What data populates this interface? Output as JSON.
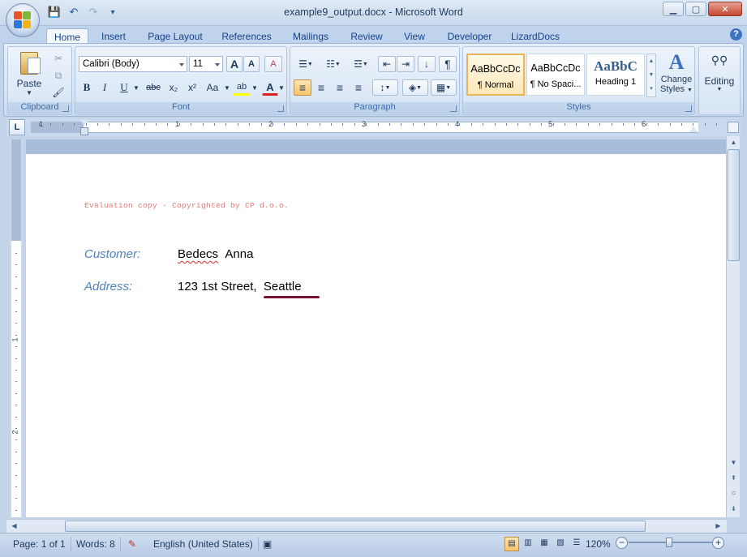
{
  "window": {
    "title": "example9_output.docx - Microsoft Word",
    "minimize": "▁",
    "maximize": "▢",
    "close": "✕"
  },
  "qat": {
    "save_icon": "💾",
    "undo_icon": "↶",
    "redo_icon": "↷",
    "customize_icon": "▾"
  },
  "tabs": [
    "Home",
    "Insert",
    "Page Layout",
    "References",
    "Mailings",
    "Review",
    "View",
    "Developer",
    "LizardDocs"
  ],
  "help": "?",
  "ribbon": {
    "clipboard": {
      "label": "Clipboard",
      "paste": "Paste",
      "cut_icon": "✂",
      "copy_icon": "⧉",
      "format_painter_icon": "🖌"
    },
    "font": {
      "label": "Font",
      "font_name": "Calibri (Body)",
      "font_size": "11",
      "grow": "A",
      "shrink": "A",
      "clear": "A",
      "bold": "B",
      "italic": "I",
      "underline": "U",
      "strike": "abc",
      "subscript": "x₂",
      "superscript": "x²",
      "change_case": "Aa",
      "highlight": "ab",
      "font_color": "A"
    },
    "paragraph": {
      "label": "Paragraph",
      "bullets_icon": "☰",
      "numbering_icon": "☷",
      "multilevel_icon": "☲",
      "decrease_indent_icon": "⇤",
      "increase_indent_icon": "⇥",
      "sort_icon": "↓",
      "pilcrow": "¶",
      "align_left_icon": "≡",
      "align_center_icon": "≡",
      "align_right_icon": "≡",
      "justify_icon": "≡",
      "line_spacing_icon": "↕",
      "shading_icon": "◈",
      "borders_icon": "▦"
    },
    "styles": {
      "label": "Styles",
      "tiles": [
        {
          "sample": "AaBbCcDc",
          "name": "¶ Normal"
        },
        {
          "sample": "AaBbCcDc",
          "name": "¶ No Spaci..."
        },
        {
          "sample": "AaBbC",
          "name": "Heading 1"
        }
      ],
      "change_styles_line1": "Change",
      "change_styles_line2": "Styles"
    },
    "editing": {
      "label": "Editing"
    }
  },
  "ruler": {
    "tab_selector": "L",
    "numbers": [
      "1",
      "1",
      "2",
      "3",
      "4",
      "5",
      "6"
    ]
  },
  "document": {
    "watermark": "Evaluation copy - Copyrighted by CP d.o.o.",
    "customer_label": "Customer:",
    "customer_first": "Bedecs",
    "customer_last": "Anna",
    "address_label": "Address:",
    "address_street": "123 1st Street,",
    "address_city": "Seattle"
  },
  "vruler_numbers": [
    "1",
    "2"
  ],
  "statusbar": {
    "page": "Page: 1 of 1",
    "words": "Words: 8",
    "language": "English (United States)",
    "zoom": "120%",
    "zoom_out": "−",
    "zoom_in": "+"
  },
  "colors": {
    "accent_label": "#4f81bd",
    "watermark": "#e37777",
    "spell_error": "#d12e2e",
    "seattle_underline": "#7a1234"
  }
}
